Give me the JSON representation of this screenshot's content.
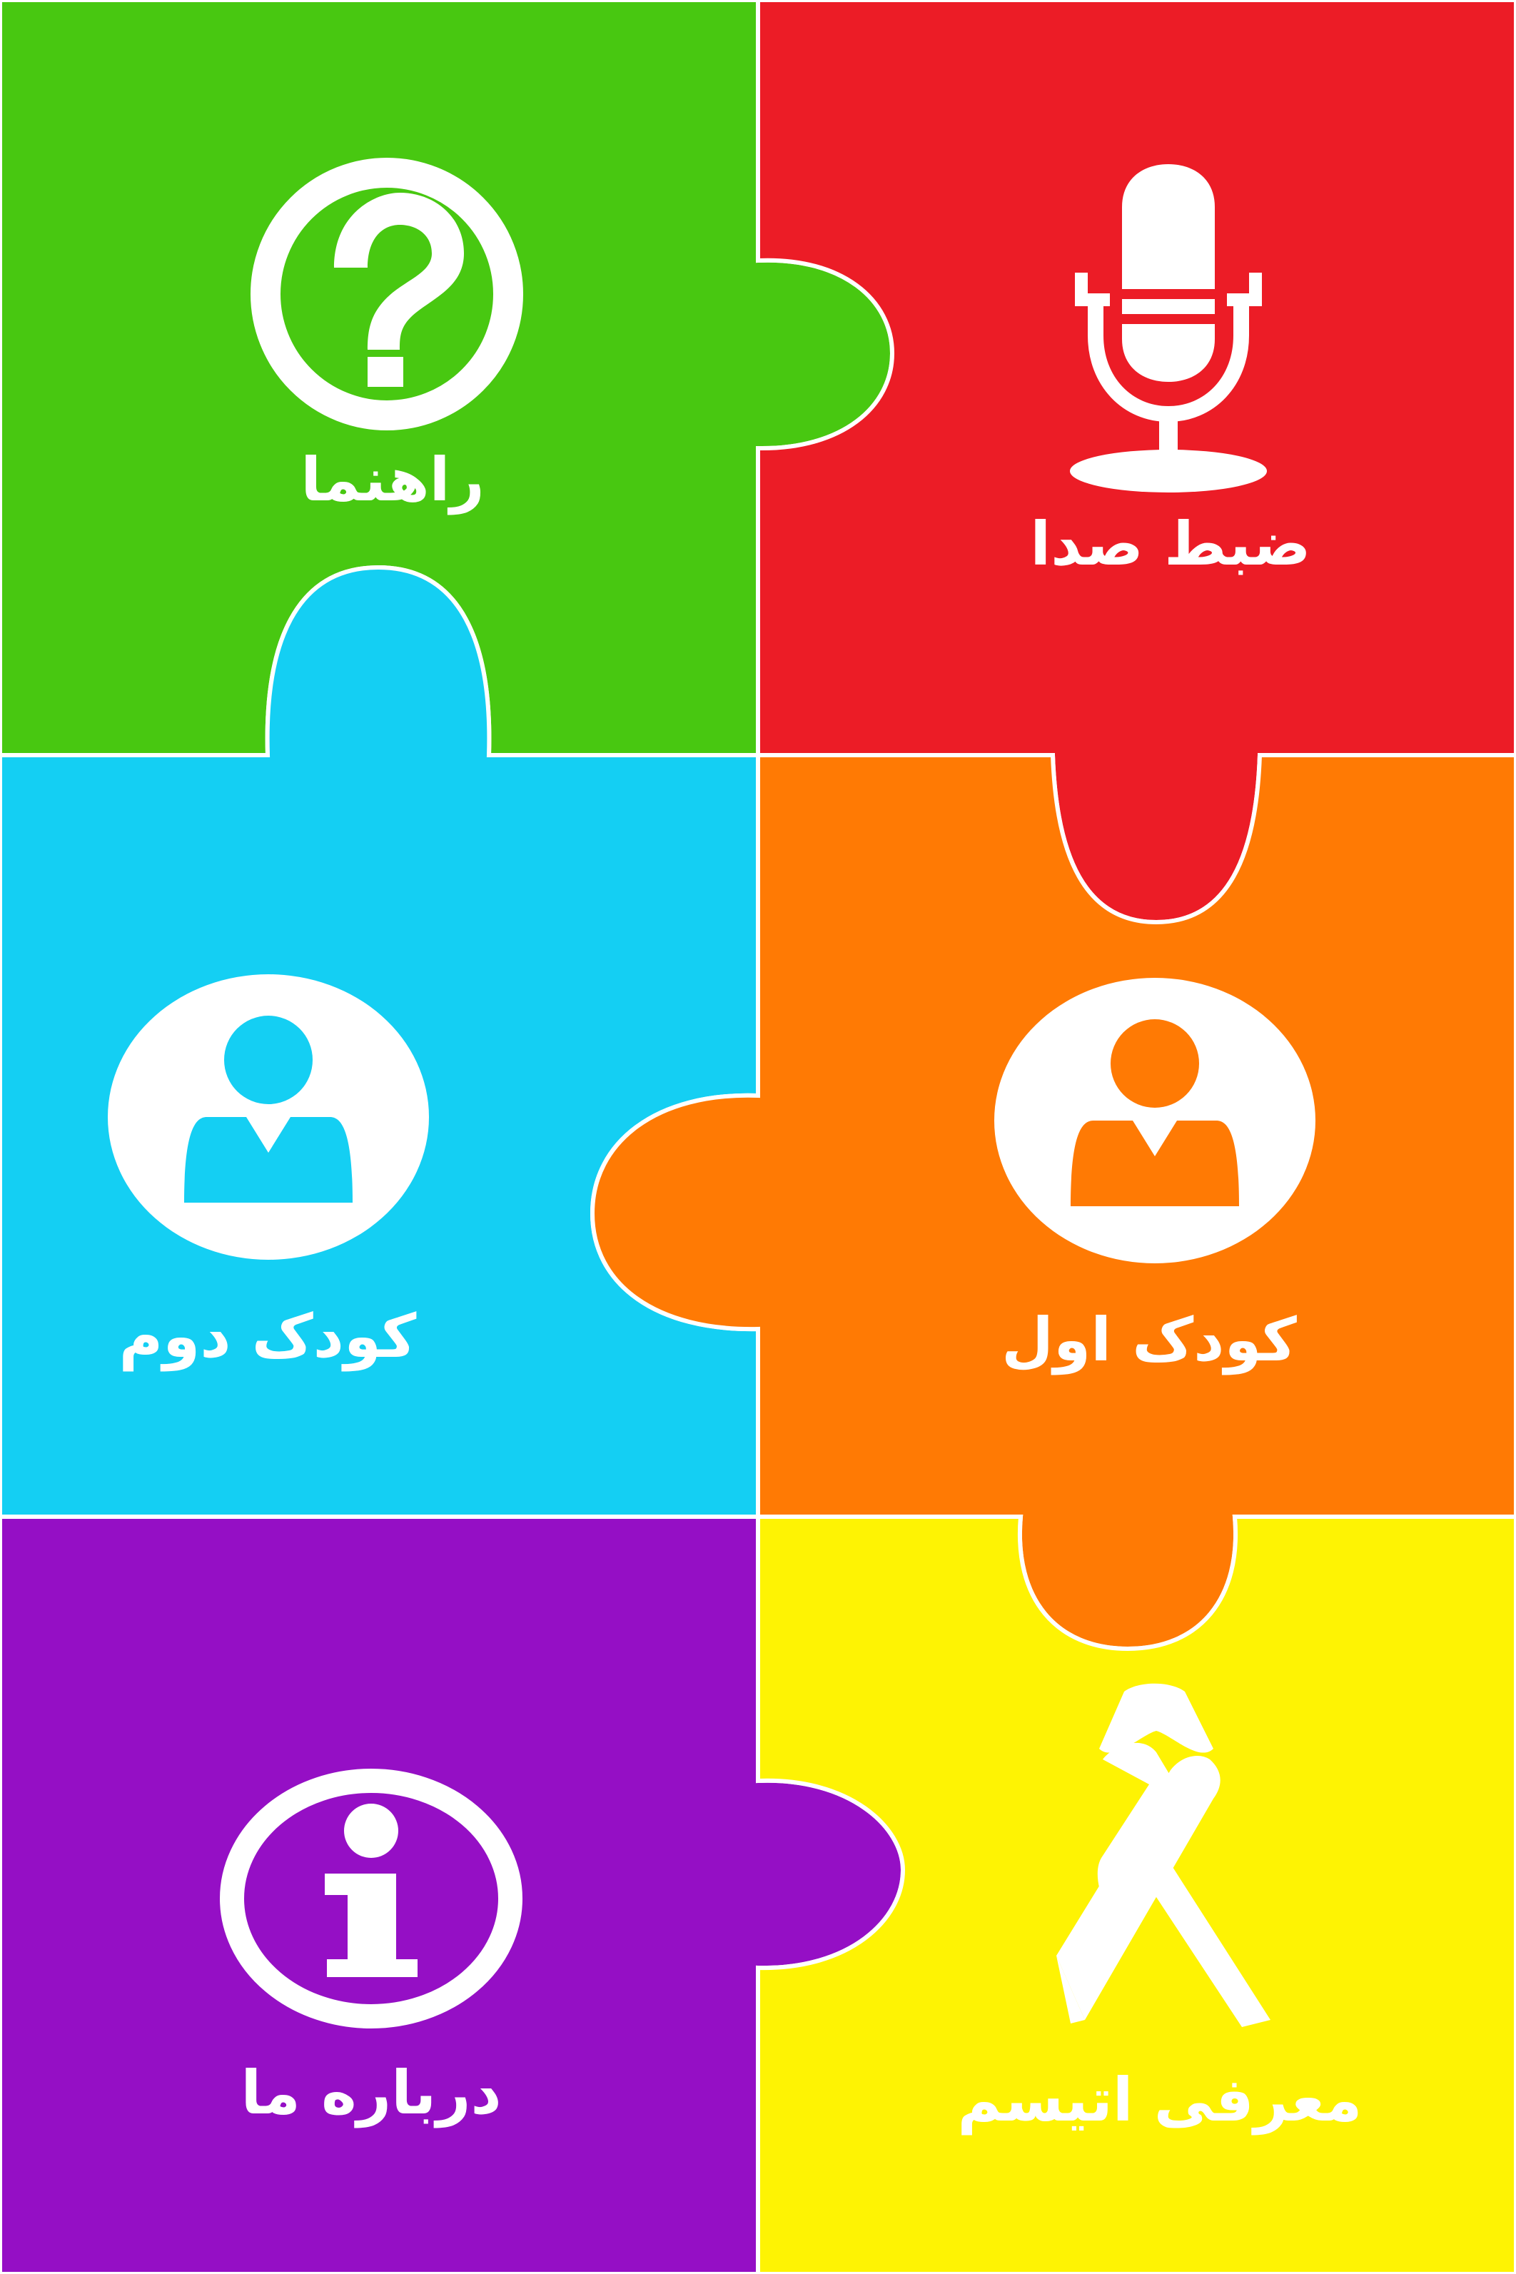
{
  "colors": {
    "green": "#48C811",
    "red": "#EC1C26",
    "cyan": "#14CFF3",
    "orange": "#FF7A04",
    "purple": "#950FC5",
    "yellow": "#FEF303",
    "outline": "#ffffff"
  },
  "menu": {
    "help": {
      "label": "راهنما",
      "icon": "question-circle-icon"
    },
    "record": {
      "label": "ضبط صدا",
      "icon": "microphone-icon"
    },
    "child_two": {
      "label": "کودک دوم",
      "icon": "user-avatar-icon"
    },
    "child_one": {
      "label": "کودک اول",
      "icon": "user-avatar-icon"
    },
    "about": {
      "label": "درباره ما",
      "icon": "info-circle-icon"
    },
    "autism": {
      "label": "معرفی اتیسم",
      "icon": "awareness-ribbon-icon"
    }
  }
}
